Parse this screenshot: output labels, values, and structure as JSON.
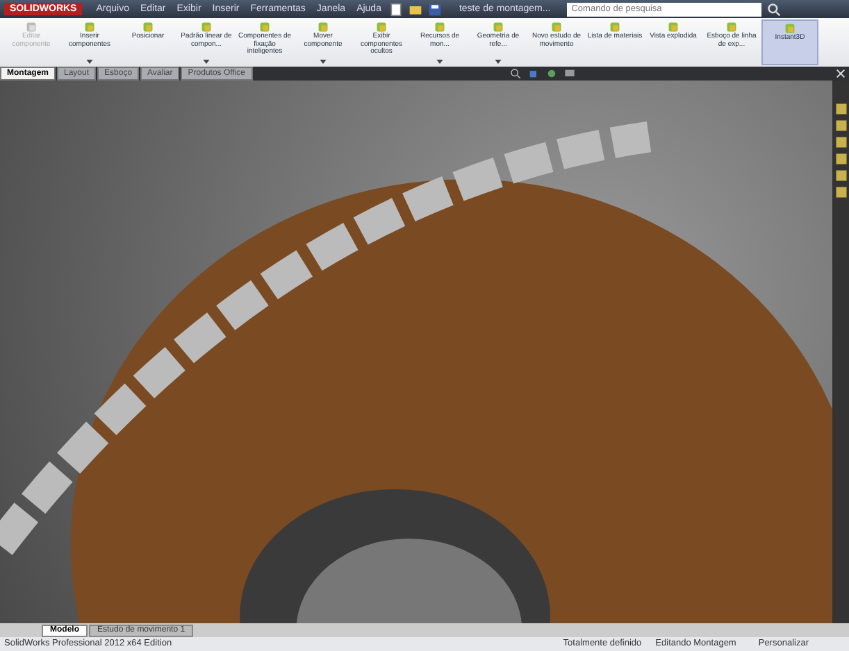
{
  "app": {
    "logo": "SOLIDWORKS",
    "menu": [
      "Arquivo",
      "Editar",
      "Exibir",
      "Inserir",
      "Ferramentas",
      "Janela",
      "Ajuda"
    ],
    "document": "teste de montagem...",
    "search": {
      "placeholder": "Comando de pesquisa"
    }
  },
  "ribbon": [
    {
      "label": "Editar componente",
      "disabled": true,
      "selected": false,
      "dropdown": false
    },
    {
      "label": "Inserir componentes",
      "disabled": false,
      "selected": false,
      "dropdown": true
    },
    {
      "label": "Posicionar",
      "disabled": false,
      "selected": false,
      "dropdown": false
    },
    {
      "label": "Padrão linear de compon...",
      "disabled": false,
      "selected": false,
      "dropdown": true
    },
    {
      "label": "Componentes de fixação inteligentes",
      "disabled": false,
      "selected": false,
      "dropdown": false
    },
    {
      "label": "Mover componente",
      "disabled": false,
      "selected": false,
      "dropdown": true
    },
    {
      "label": "Exibir componentes ocultos",
      "disabled": false,
      "selected": false,
      "dropdown": false
    },
    {
      "label": "Recursos de mon...",
      "disabled": false,
      "selected": false,
      "dropdown": true
    },
    {
      "label": "Geometria de refe...",
      "disabled": false,
      "selected": false,
      "dropdown": true
    },
    {
      "label": "Novo estudo de movimento",
      "disabled": false,
      "selected": false,
      "dropdown": false
    },
    {
      "label": "Lista de materiais",
      "disabled": false,
      "selected": false,
      "dropdown": false
    },
    {
      "label": "Vista explodida",
      "disabled": false,
      "selected": false,
      "dropdown": false
    },
    {
      "label": "Esboço de linha de exp...",
      "disabled": false,
      "selected": false,
      "dropdown": false
    },
    {
      "label": "Instant3D",
      "disabled": false,
      "selected": true,
      "dropdown": false
    }
  ],
  "tabs": [
    {
      "label": "Montagem",
      "selected": true
    },
    {
      "label": "Layout",
      "selected": false
    },
    {
      "label": "Esboço",
      "selected": false
    },
    {
      "label": "Avaliar",
      "selected": false
    },
    {
      "label": "Produtos Office",
      "selected": false
    }
  ],
  "bottom_tabs": [
    {
      "label": "Modelo",
      "selected": true
    },
    {
      "label": "Estudo de movimento 1",
      "selected": false
    }
  ],
  "status_bar": {
    "edition": "SolidWorks Professional 2012 x64 Edition",
    "state": "Totalmente definido",
    "mode": "Editando Montagem",
    "customize": "Personalizar"
  }
}
